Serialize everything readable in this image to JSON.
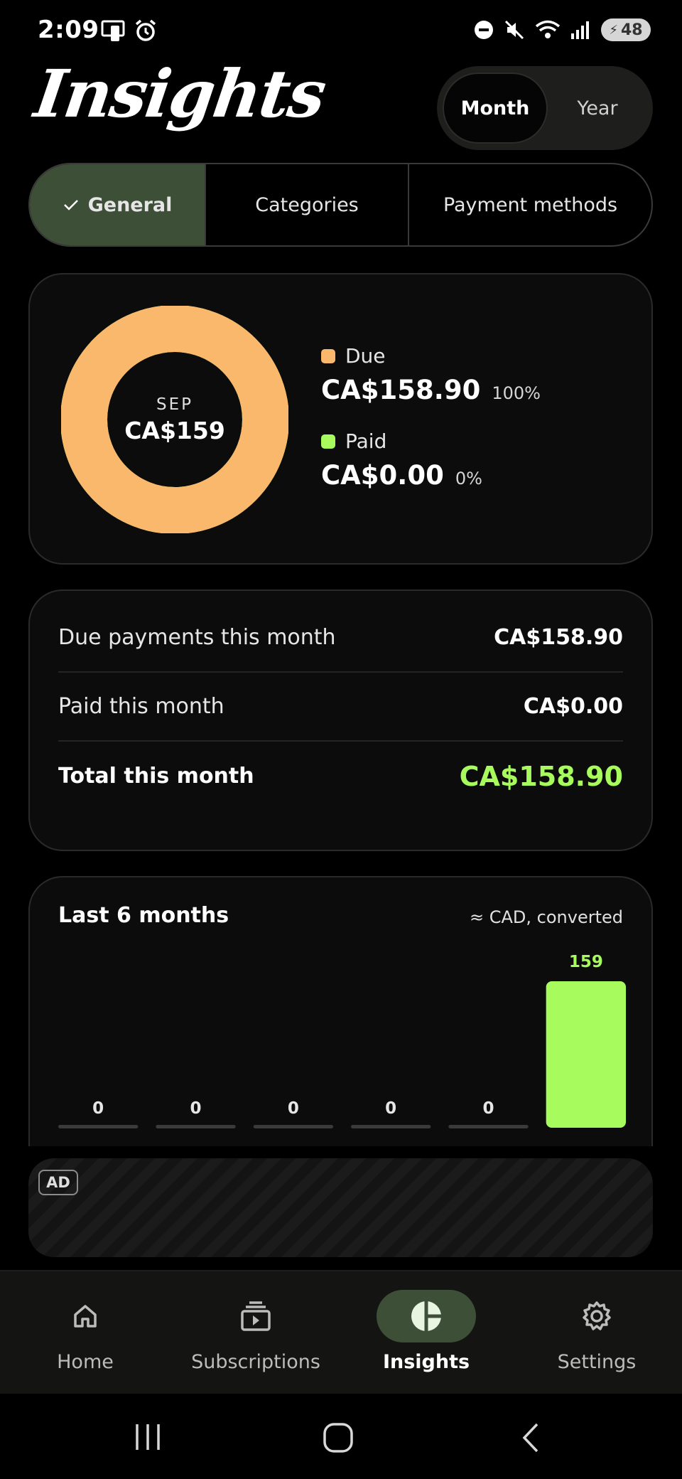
{
  "status_bar": {
    "time": "2:09",
    "battery": "48",
    "icons": [
      "screen-mirror-icon",
      "alarm-icon",
      "dnd-icon",
      "mute-icon",
      "wifi-icon",
      "signal-icon"
    ]
  },
  "header": {
    "title": "Insights",
    "period_options": [
      "Month",
      "Year"
    ],
    "period_selected": "Month"
  },
  "tabs": {
    "items": [
      "General",
      "Categories",
      "Payment methods"
    ],
    "selected": "General"
  },
  "overview": {
    "month": "SEP",
    "center_amount": "CA$159",
    "due_fraction": 1.0,
    "colors": {
      "due": "#f9b86b",
      "paid": "#a8fb5c"
    },
    "legend": [
      {
        "label": "Due",
        "amount": "CA$158.90",
        "percent": "100%"
      },
      {
        "label": "Paid",
        "amount": "CA$0.00",
        "percent": "0%"
      }
    ]
  },
  "summary": {
    "rows": [
      {
        "label": "Due payments this month",
        "value": "CA$158.90"
      },
      {
        "label": "Paid this month",
        "value": "CA$0.00"
      },
      {
        "label": "Total this month",
        "value": "CA$158.90"
      }
    ]
  },
  "chart": {
    "title": "Last 6 months",
    "note": "≈ CAD, converted"
  },
  "chart_data": {
    "type": "bar",
    "title": "Last 6 months",
    "subtitle": "≈ CAD, converted",
    "categories": [
      "",
      "",
      "",
      "",
      "",
      ""
    ],
    "values": [
      0,
      0,
      0,
      0,
      0,
      159
    ],
    "data_labels": [
      "0",
      "0",
      "0",
      "0",
      "0",
      "159"
    ],
    "ylim": [
      0,
      159
    ],
    "grid": false,
    "bar_color": "#a8fb5c",
    "baseline_color": "#3a3a3a"
  },
  "ad": {
    "badge": "AD"
  },
  "bottom_nav": {
    "items": [
      {
        "label": "Home",
        "icon": "home-icon"
      },
      {
        "label": "Subscriptions",
        "icon": "subscriptions-icon"
      },
      {
        "label": "Insights",
        "icon": "insights-icon"
      },
      {
        "label": "Settings",
        "icon": "gear-icon"
      }
    ],
    "selected": "Insights"
  },
  "system_nav": [
    "recents-button",
    "home-button",
    "back-button"
  ]
}
